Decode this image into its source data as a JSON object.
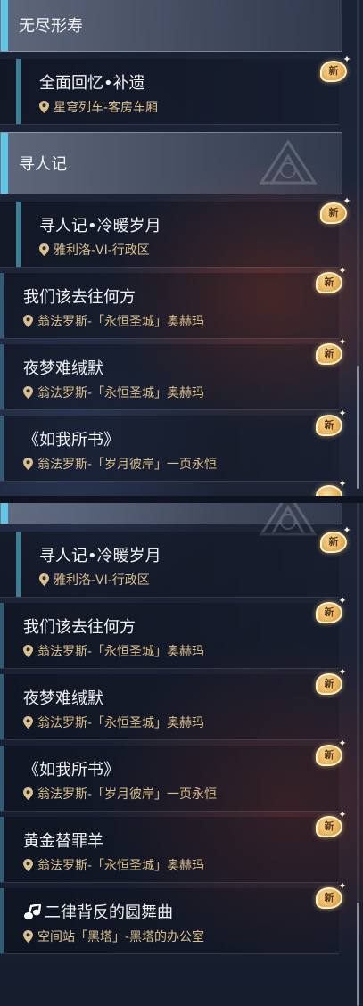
{
  "top_panel": {
    "sections": [
      {
        "label": "无尽形寿"
      },
      {
        "label": "寻人记"
      }
    ],
    "items": [
      {
        "title": "全面回忆•补遗",
        "location": "星穹列车-客房车厢",
        "badge": "新"
      },
      {
        "title": "寻人记•冷暖岁月",
        "location": "雅利洛-VI-行政区",
        "badge": "新"
      },
      {
        "title": "我们该去往何方",
        "location": "翁法罗斯-「永恒圣城」奥赫玛",
        "badge": "新"
      },
      {
        "title": "夜梦难缄默",
        "location": "翁法罗斯-「永恒圣城」奥赫玛",
        "badge": "新"
      },
      {
        "title": "《如我所书》",
        "location": "翁法罗斯-「岁月彼岸」一页永恒",
        "badge": "新"
      }
    ]
  },
  "bottom_panel": {
    "items": [
      {
        "title": "寻人记•冷暖岁月",
        "location": "雅利洛-VI-行政区",
        "badge": "新"
      },
      {
        "title": "我们该去往何方",
        "location": "翁法罗斯-「永恒圣城」奥赫玛",
        "badge": "新"
      },
      {
        "title": "夜梦难缄默",
        "location": "翁法罗斯-「永恒圣城」奥赫玛",
        "badge": "新"
      },
      {
        "title": "《如我所书》",
        "location": "翁法罗斯-「岁月彼岸」一页永恒",
        "badge": "新"
      },
      {
        "title": "黄金替罪羊",
        "location": "翁法罗斯-「永恒圣城」奥赫玛",
        "badge": "新"
      },
      {
        "title": "二律背反的圆舞曲",
        "location": "空间站「黑塔」-黑塔的办公室",
        "badge": "新",
        "icon": "music-note-icon"
      }
    ]
  },
  "colors": {
    "accent": "#5fc8e8",
    "item_bar": "#3f7c96",
    "location_text": "#d9c08f",
    "badge": "#e3a94e"
  }
}
